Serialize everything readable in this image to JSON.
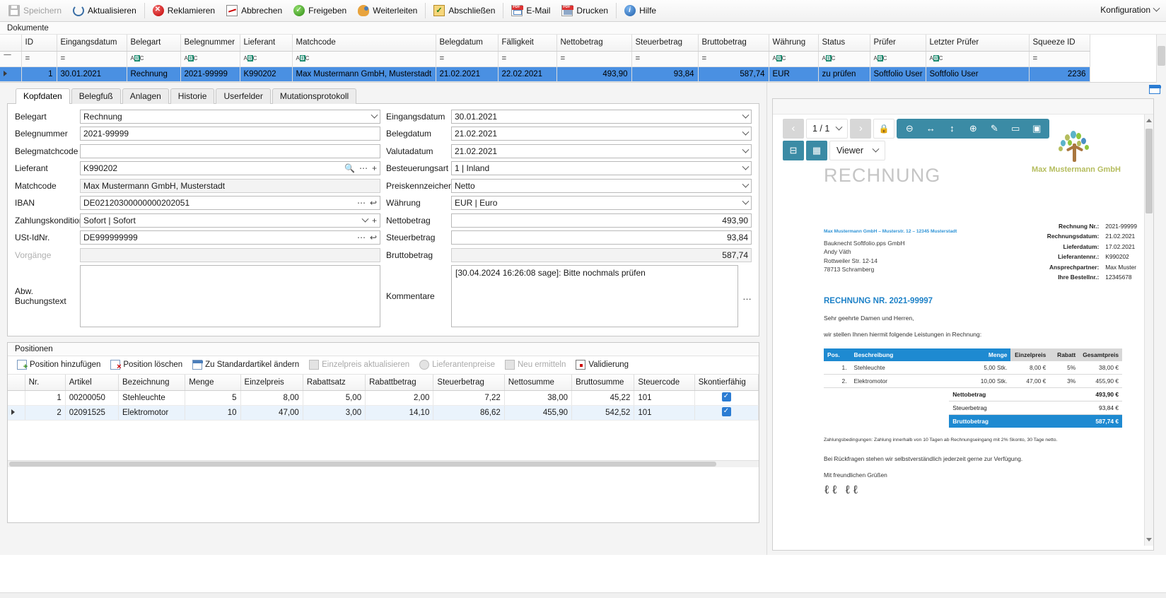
{
  "toolbar": {
    "buttons": [
      {
        "label": "Speichern",
        "icon": "save-icon",
        "disabled": true
      },
      {
        "label": "Aktualisieren",
        "icon": "refresh-icon",
        "disabled": false
      },
      {
        "label": "Reklamieren",
        "icon": "complaint-icon",
        "disabled": false
      },
      {
        "label": "Abbrechen",
        "icon": "cancel-icon",
        "disabled": false
      },
      {
        "label": "Freigeben",
        "icon": "approve-icon",
        "disabled": false
      },
      {
        "label": "Weiterleiten",
        "icon": "forward-icon",
        "disabled": false
      },
      {
        "label": "Abschließen",
        "icon": "complete-icon",
        "disabled": false
      },
      {
        "label": "E-Mail",
        "icon": "email-pdf-icon",
        "disabled": false
      },
      {
        "label": "Drucken",
        "icon": "print-pdf-icon",
        "disabled": false
      },
      {
        "label": "Hilfe",
        "icon": "help-icon",
        "disabled": false
      }
    ],
    "config_label": "Konfiguration"
  },
  "documents": {
    "caption": "Dokumente",
    "columns": [
      "ID",
      "Eingangsdatum",
      "Belegart",
      "Belegnummer",
      "Lieferant",
      "Matchcode",
      "Belegdatum",
      "Fälligkeit",
      "Nettobetrag",
      "Steuerbetrag",
      "Bruttobetrag",
      "Währung",
      "Status",
      "Prüfer",
      "Letzter Prüfer",
      "Squeeze ID"
    ],
    "filter_row": [
      "=",
      "=",
      "abc",
      "abc",
      "abc",
      "abc",
      "=",
      "=",
      "=",
      "=",
      "=",
      "abc",
      "abc",
      "abc",
      "abc",
      "="
    ],
    "rows": [
      {
        "cells": [
          "1",
          "30.01.2021",
          "Rechnung",
          "2021-99999",
          "K990202",
          "Max Mustermann GmbH, Musterstadt",
          "21.02.2021",
          "22.02.2021",
          "493,90",
          "93,84",
          "587,74",
          "EUR",
          "zu prüfen",
          "Softfolio User",
          "Softfolio User",
          "2236"
        ],
        "selected": true
      }
    ]
  },
  "tabs": [
    {
      "label": "Kopfdaten",
      "active": true
    },
    {
      "label": "Belegfuß",
      "active": false
    },
    {
      "label": "Anlagen",
      "active": false
    },
    {
      "label": "Historie",
      "active": false
    },
    {
      "label": "Userfelder",
      "active": false
    },
    {
      "label": "Mutationsprotokoll",
      "active": false
    }
  ],
  "form_left": [
    {
      "label": "Belegart",
      "value": "Rechnung",
      "type": "combo",
      "readonly": false
    },
    {
      "label": "Belegnummer",
      "value": "2021-99999",
      "type": "text",
      "readonly": false
    },
    {
      "label": "Belegmatchcode",
      "value": "",
      "type": "text",
      "readonly": false
    },
    {
      "label": "Lieferant",
      "value": "K990202",
      "type": "lookup",
      "readonly": false
    },
    {
      "label": "Matchcode",
      "value": "Max Mustermann GmbH, Musterstadt",
      "type": "text",
      "readonly": true
    },
    {
      "label": "IBAN",
      "value": "DE02120300000000202051",
      "type": "ellipsis-undo",
      "readonly": false
    },
    {
      "label": "Zahlungskondition",
      "value": "Sofort | Sofort",
      "type": "combo-plus",
      "readonly": false
    },
    {
      "label": "USt-IdNr.",
      "value": "DE999999999",
      "type": "ellipsis-undo",
      "readonly": false
    },
    {
      "label": "Vorgänge",
      "value": "",
      "type": "text",
      "readonly": true,
      "label_dim": true
    }
  ],
  "form_left_textarea": {
    "label": "Abw. Buchungstext",
    "value": ""
  },
  "form_right": [
    {
      "label": "Eingangsdatum",
      "value": "30.01.2021",
      "type": "combo",
      "readonly": false
    },
    {
      "label": "Belegdatum",
      "value": "21.02.2021",
      "type": "combo",
      "readonly": false
    },
    {
      "label": "Valutadatum",
      "value": "21.02.2021",
      "type": "combo",
      "readonly": false
    },
    {
      "label": "Besteuerungsart",
      "value": "1 | Inland",
      "type": "combo",
      "readonly": false
    },
    {
      "label": "Preiskennzeichen",
      "value": "Netto",
      "type": "combo",
      "readonly": false
    },
    {
      "label": "Währung",
      "value": "EUR | Euro",
      "type": "combo",
      "readonly": false
    },
    {
      "label": "Nettobetrag",
      "value": "493,90",
      "type": "number",
      "readonly": false
    },
    {
      "label": "Steuerbetrag",
      "value": "93,84",
      "type": "number",
      "readonly": false
    },
    {
      "label": "Bruttobetrag",
      "value": "587,74",
      "type": "number",
      "readonly": true
    }
  ],
  "form_right_textarea": {
    "label": "Kommentare",
    "value": "[30.04.2024 16:26:08 sage]: Bitte nochmals prüfen",
    "ellipsis": "…"
  },
  "positions": {
    "caption": "Positionen",
    "toolbar": [
      {
        "label": "Position hinzufügen",
        "icon": "add-position-icon",
        "disabled": false
      },
      {
        "label": "Position löschen",
        "icon": "delete-position-icon",
        "disabled": false
      },
      {
        "label": "Zu Standardartikel ändern",
        "icon": "standard-article-icon",
        "disabled": false
      },
      {
        "label": "Einzelpreis aktualisieren",
        "icon": "update-unitprice-icon",
        "disabled": true
      },
      {
        "label": "Lieferantenpreise",
        "icon": "supplier-prices-icon",
        "disabled": true
      },
      {
        "label": "Neu ermitteln",
        "icon": "recalculate-icon",
        "disabled": true
      },
      {
        "label": "Validierung",
        "icon": "validation-icon",
        "disabled": false
      }
    ],
    "columns": [
      "Nr.",
      "Artikel",
      "Bezeichnung",
      "Menge",
      "Einzelpreis",
      "Rabattsatz",
      "Rabattbetrag",
      "Steuerbetrag",
      "Nettosumme",
      "Bruttosumme",
      "Steuercode",
      "Skontierfähig"
    ],
    "rows": [
      {
        "nr": "1",
        "artikel": "00200050",
        "bezeichnung": "Stehleuchte",
        "menge": "5",
        "einzelpreis": "8,00",
        "rabattsatz": "5,00",
        "rabattbetrag": "2,00",
        "steuerbetrag": "7,22",
        "nettosumme": "38,00",
        "bruttosumme": "45,22",
        "steuercode": "101",
        "skontierfaehig": true,
        "selected": false
      },
      {
        "nr": "2",
        "artikel": "02091525",
        "bezeichnung": "Elektromotor",
        "menge": "10",
        "einzelpreis": "47,00",
        "rabattsatz": "3,00",
        "rabattbetrag": "14,10",
        "steuerbetrag": "86,62",
        "nettosumme": "455,90",
        "bruttosumme": "542,52",
        "steuercode": "101",
        "skontierfaehig": true,
        "selected": true
      }
    ]
  },
  "viewer": {
    "page_indicator": "1 / 1",
    "mode_label": "Viewer",
    "tools": [
      {
        "name": "zoom-out-icon",
        "glyph": "⊖"
      },
      {
        "name": "fit-width-icon",
        "glyph": "↔"
      },
      {
        "name": "fit-height-icon",
        "glyph": "↕"
      },
      {
        "name": "zoom-in-icon",
        "glyph": "⊕"
      },
      {
        "name": "annotate-pen-icon",
        "glyph": "✎"
      },
      {
        "name": "note-icon",
        "glyph": "▭"
      },
      {
        "name": "stamp-icon",
        "glyph": "▣"
      }
    ],
    "lock_icon": "lock-icon",
    "prev_glyph": "‹",
    "next_glyph": "›",
    "split-view-icon": "split-view-icon",
    "grid-view-icon": "grid-view-icon"
  },
  "pdf": {
    "title": "RECHNUNG",
    "logo_name": "Max Mustermann GmbH",
    "sender_line": "Max Mustermann GmbH – Musterstr. 12 – 12345 Musterstadt",
    "address": [
      "Bauknecht Softfolio.pps GmbH",
      "Andy Väth",
      "Rottweiler Str. 12-14",
      "78713 Schramberg"
    ],
    "meta": [
      {
        "k": "Rechnung Nr.:",
        "v": "2021-99999"
      },
      {
        "k": "Rechnungsdatum:",
        "v": "21.02.2021"
      },
      {
        "k": "Lieferdatum:",
        "v": "17.02.2021"
      },
      {
        "k": "Lieferantennr.:",
        "v": "K990202"
      },
      {
        "k": "Ansprechpartner:",
        "v": "Max Muster"
      },
      {
        "k": "Ihre Bestellnr.:",
        "v": "12345678"
      }
    ],
    "invoice_no": "RECHNUNG NR. 2021-99997",
    "salutation": "Sehr geehrte Damen und Herren,",
    "intro": "wir stellen Ihnen hiermit folgende Leistungen in Rechnung:",
    "table_head": [
      "Pos.",
      "Beschreibung",
      "Menge",
      "Einzelpreis",
      "Rabatt",
      "Gesamtpreis"
    ],
    "table_rows": [
      {
        "pos": "1.",
        "desc": "Stehleuchte",
        "menge": "5,00 Stk.",
        "einzel": "8,00 €",
        "rabatt": "5%",
        "gesamt": "38,00 €"
      },
      {
        "pos": "2.",
        "desc": "Elektromotor",
        "menge": "10,00 Stk.",
        "einzel": "47,00 €",
        "rabatt": "3%",
        "gesamt": "455,90 €"
      }
    ],
    "sums": [
      {
        "k": "Nettobetrag",
        "v": "493,90 €",
        "style": "l"
      },
      {
        "k": "Steuerbetrag",
        "v": "93,84 €",
        "style": "m"
      },
      {
        "k": "Bruttobetrag",
        "v": "587,74 €",
        "style": "b"
      }
    ],
    "terms": "Zahlungsbedingungen: Zahlung innerhalb von 10 Tagen ab Rechnungseingang mit 2% Skonto, 30 Tage netto.",
    "closing1": "Bei Rückfragen stehen wir selbstverständlich jederzeit gerne zur Verfügung.",
    "closing2": "Mit freundlichen Grüßen",
    "signature": "ℓℓ ℓℓ"
  },
  "colors": {
    "accent_blue": "#2b7cd3",
    "grid_selection": "#4a90e2",
    "teal_toolbar": "#3b8ba5",
    "pdf_blue": "#1e8ad1",
    "logo_olive": "#b5bd5e"
  }
}
